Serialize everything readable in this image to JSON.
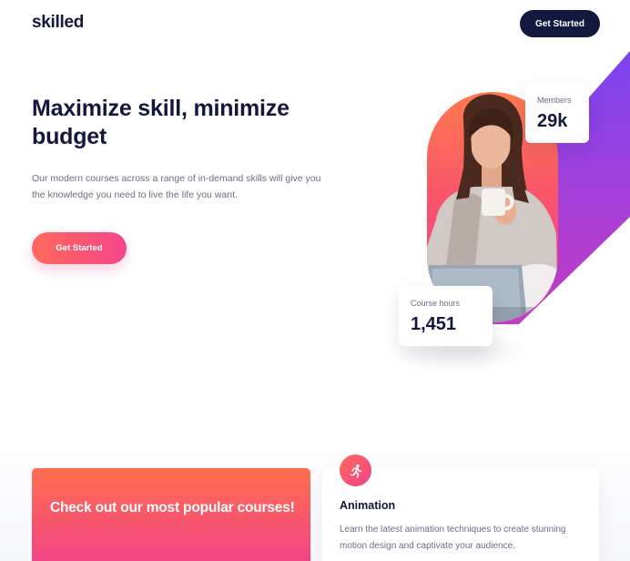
{
  "brand": {
    "logo": "skilled",
    "colors": {
      "navy": "#13183f",
      "coral": "#ff6a5a",
      "pink": "#f0438a",
      "purple": "#6f4cf0"
    }
  },
  "header": {
    "cta_label": "Get Started"
  },
  "hero": {
    "title": "Maximize skill, minimize budget",
    "description": "Our modern courses across a range of in-demand skills will give you the knowledge you need to live the life you want.",
    "cta_label": "Get Started",
    "image_alt": "woman drinking coffee at laptop"
  },
  "stats": {
    "members": {
      "label": "Members",
      "value": "29k"
    },
    "course_hours": {
      "label": "Course hours",
      "value": "1,451"
    }
  },
  "courses": {
    "promo_text": "Check out our most popular courses!",
    "items": [
      {
        "icon": "running-person-icon",
        "title": "Animation",
        "description": "Learn the latest animation techniques to create stunning motion design and captivate your audience."
      }
    ]
  }
}
